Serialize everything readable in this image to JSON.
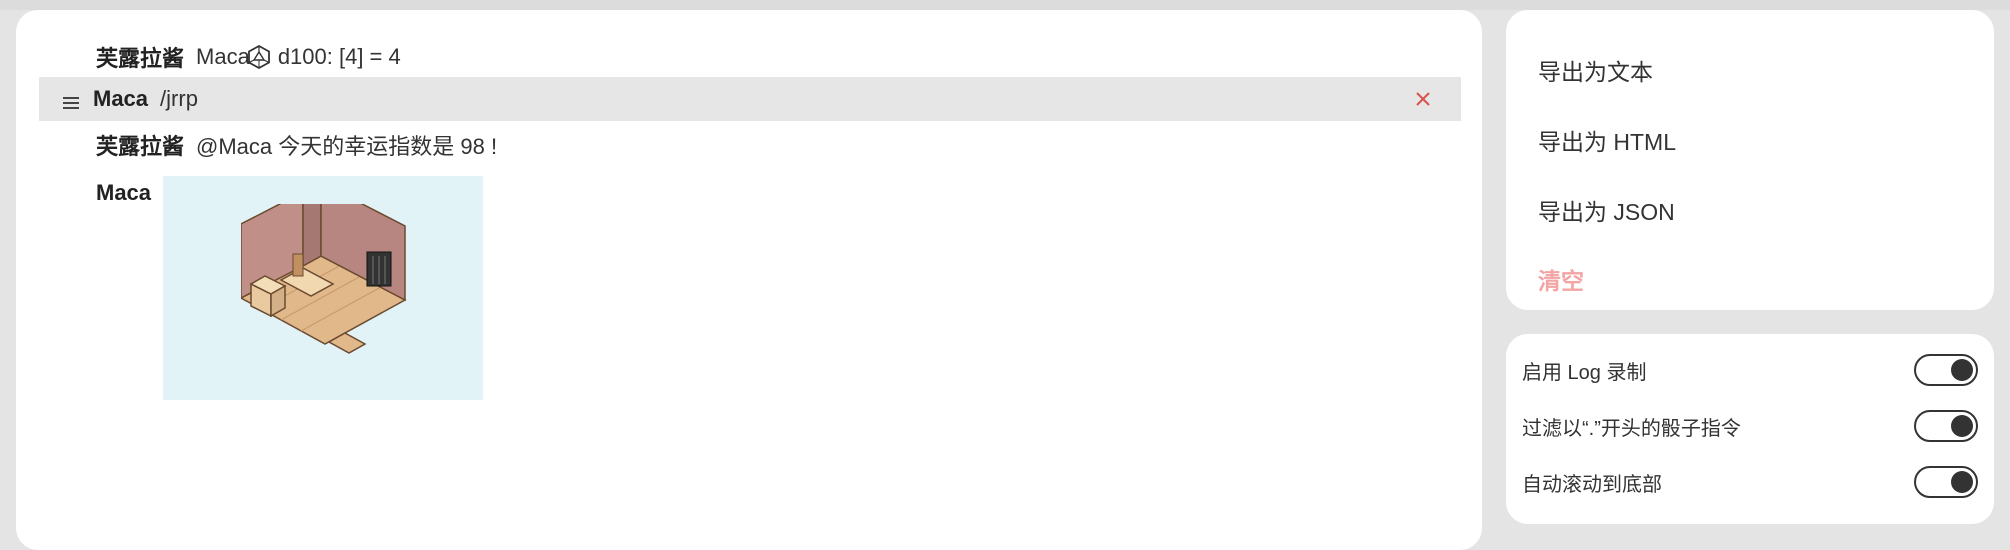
{
  "log": {
    "messages": [
      {
        "name": "芙露拉酱",
        "prefix": "Maca",
        "dice_icon": "d20-icon",
        "text": "d100: [4] = 4"
      },
      {
        "name": "Maca",
        "text": "/jrrp",
        "highlighted": true
      },
      {
        "name": "芙露拉酱",
        "text": "@Maca 今天的幸运指数是 98 !"
      },
      {
        "name": "Maca",
        "image": "isometric-room-image"
      }
    ]
  },
  "export_menu": {
    "items": [
      "导出为文本",
      "导出为 HTML",
      "导出为 JSON"
    ],
    "clear_label": "清空",
    "clear_color": "#f3a5a5"
  },
  "settings": {
    "options": [
      {
        "label": "启用 Log 录制",
        "enabled": true
      },
      {
        "label": "过滤以“.”开头的骰子指令",
        "enabled": true
      },
      {
        "label": "自动滚动到底部",
        "enabled": true
      }
    ]
  },
  "colors": {
    "highlight_row": "#e6e6e6",
    "close_icon": "#d9534f",
    "image_bg": "#e1f3f7"
  }
}
